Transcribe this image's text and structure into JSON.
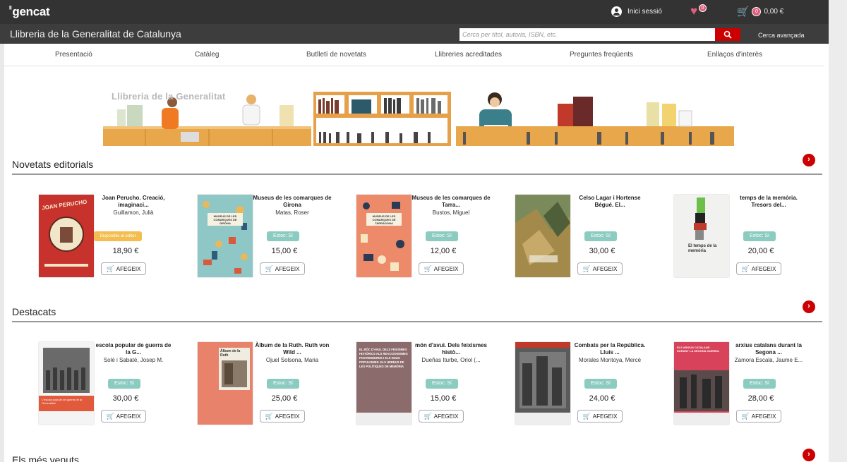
{
  "header": {
    "logo": "gencat",
    "login_label": "Inici sessió",
    "favorites_count": "0",
    "cart_count": "0",
    "cart_total": "0,00 €"
  },
  "subheader": {
    "site_title": "Llibreria de la Generalitat de Catalunya",
    "search_placeholder": "Cerca per títol, autoria, ISBN, etc.",
    "advanced_search": "Cerca avançada"
  },
  "nav": [
    "Presentació",
    "Catàleg",
    "Butlletí de novetats",
    "Llibreries acreditades",
    "Preguntes freqüents",
    "Enllaços d'interès"
  ],
  "banner": {
    "text": "Llibreria de la Generalitat"
  },
  "add_label": "AFEGEIX",
  "sections": [
    {
      "title": "Novetats editorials",
      "items": [
        {
          "title": "Joan Perucho. Creació, imaginaci...",
          "author": "Guillamon, Julià",
          "stock": "Disponible al editor",
          "price": "18,90 €"
        },
        {
          "title": "Museus de les comarques de Girona",
          "author": "Matas, Roser",
          "stock": "Estoc: Sí",
          "price": "15,00 €"
        },
        {
          "title": "Museus de les comarques de Tarra...",
          "author": "Bustos, Miguel",
          "stock": "Estoc: Sí",
          "price": "12,00 €"
        },
        {
          "title": "Celso Lagar i Hortense Bégué. El...",
          "author": "",
          "stock": "Estoc: Sí",
          "price": "30,00 €"
        },
        {
          "title": "temps de la memòria. Tresors del...",
          "author": "",
          "stock": "Estoc: Sí",
          "price": "20,00 €"
        }
      ]
    },
    {
      "title": "Destacats",
      "items": [
        {
          "title": "escola popular de guerra de la G...",
          "author": "Solé i Sabaté, Josep M.",
          "stock": "Estoc: Sí",
          "price": "30,00 €"
        },
        {
          "title": "Àlbum de la Ruth. Ruth von Wild ...",
          "author": "Ojuel Solsona, Maria",
          "stock": "Estoc: Sí",
          "price": "25,00 €"
        },
        {
          "title": "món d'avui. Dels feixismes histò...",
          "author": "Dueñas Iturbe, Oriol (...",
          "stock": "Estoc: Sí",
          "price": "15,00 €"
        },
        {
          "title": "Combats per la República. Lluís ...",
          "author": "Morales Montoya, Mercè",
          "stock": "Estoc: Sí",
          "price": "24,00 €"
        },
        {
          "title": "arxius catalans durant la Segona ...",
          "author": "Zamora Escala, Jaume E...",
          "stock": "Estoc: Sí",
          "price": "28,00 €"
        }
      ]
    },
    {
      "title": "Els més venuts",
      "items": []
    }
  ],
  "covers": {
    "perucho_title": "JOAN PERUCHO",
    "girona_title": "MUSEUS DE LES COMARQUES DE GIRONA",
    "tarragona_title": "MUSEUS DE LES COMARQUES DE TARRAGONA",
    "memoria_title": "El temps de la memòria",
    "odi_title": "EL BÒC D'AVUI. DELS FEIXISMES HISTÒRICS ALS REACCIONISMES POSTMODERNS I ELS NOUS POPULISMES. ELS HEREUS DE LES POLÍTIQUES DE MEMÒRIA",
    "album_title": "Àlbum de la Ruth",
    "escola_title": "L'escola popular de guerra de la Generalitat",
    "arxius_title": "ELS ARXIUS CATALANS DURANT LA SEGONA GUERRA"
  }
}
